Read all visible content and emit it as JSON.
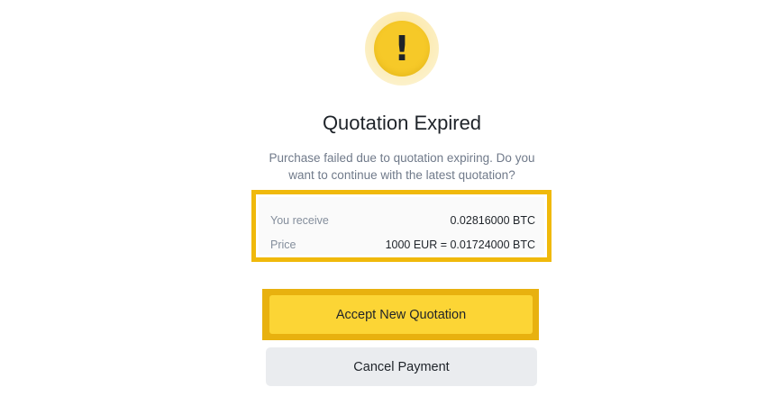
{
  "dialog": {
    "icon": "exclamation-warning-icon",
    "icon_glyph": "!",
    "title": "Quotation Expired",
    "description": "Purchase failed due to quotation expiring. Do you want to continue with the latest quotation?"
  },
  "quote": {
    "rows": [
      {
        "label": "You receive",
        "value": "0.02816000 BTC"
      },
      {
        "label": "Price",
        "value": "1000 EUR = 0.01724000 BTC"
      }
    ]
  },
  "actions": {
    "accept_label": "Accept New Quotation",
    "cancel_label": "Cancel Payment"
  },
  "colors": {
    "accent_yellow": "#fcd535",
    "highlight_border": "#f0b90b",
    "secondary_button": "#eaecef",
    "muted_text": "#707a8a"
  }
}
